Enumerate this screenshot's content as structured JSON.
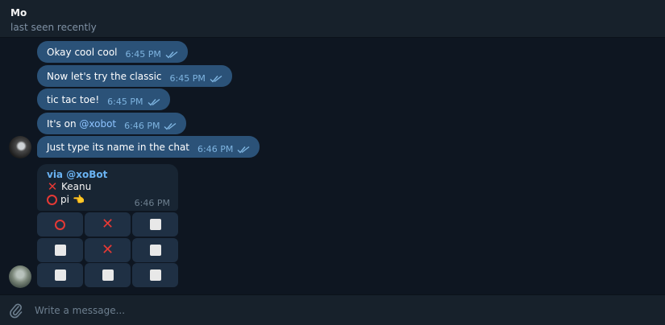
{
  "header": {
    "name": "Mo",
    "status": "last seen recently"
  },
  "messages": [
    {
      "text": "Okay cool cool",
      "time": "6:45 PM"
    },
    {
      "text": "Now let's try the classic",
      "time": "6:45 PM"
    },
    {
      "text": "tic tac toe!",
      "time": "6:45 PM"
    },
    {
      "text_prefix": "It's on ",
      "mention": "@xobot",
      "time": "6:46 PM"
    },
    {
      "text": "Just type its name in the chat",
      "time": "6:46 PM"
    }
  ],
  "game": {
    "via": "via @xoBot",
    "player1": "Keanu",
    "player2": "pi",
    "player2_emoji": "👈",
    "time": "6:46 PM",
    "board": [
      [
        "O",
        "X",
        ""
      ],
      [
        "",
        "X",
        ""
      ],
      [
        "",
        "",
        ""
      ]
    ]
  },
  "composer": {
    "placeholder": "Write a message..."
  },
  "icons": [
    "double-check-icon",
    "paperclip-icon",
    "x-mark-icon",
    "o-mark-icon",
    "empty-cell-icon"
  ],
  "colors": {
    "outgoing_bubble": "#2b5278",
    "incoming_bubble": "#182533",
    "mark_red": "#e53935",
    "link": "#6ab3f3"
  }
}
